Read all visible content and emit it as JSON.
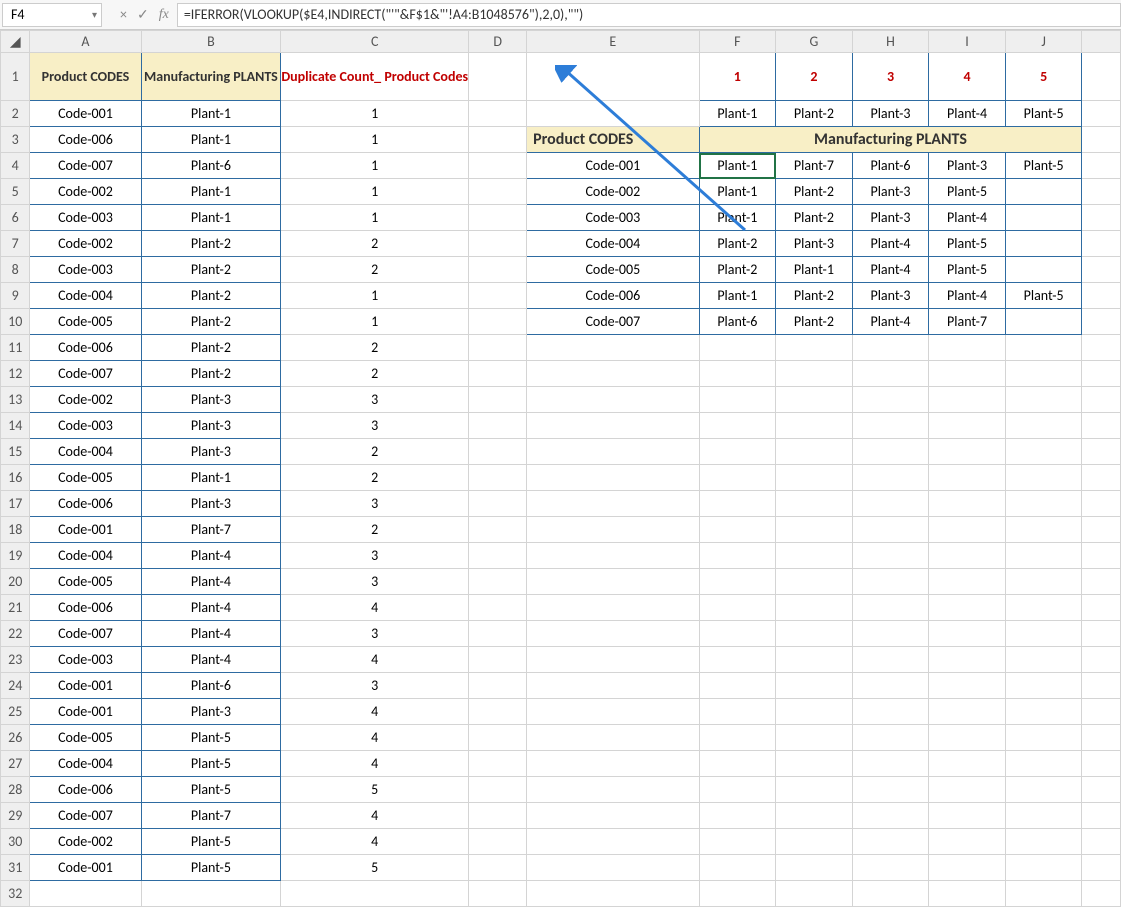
{
  "name_box": "F4",
  "formula_bar": "=IFERROR(VLOOKUP($E4,INDIRECT(\"'\"&F$1&\"'!A4:B1048576\"),2,0),\"\")",
  "icons": {
    "cancel": "×",
    "enter": "✓",
    "fx": "fx"
  },
  "col_headers": [
    "A",
    "B",
    "C",
    "D",
    "E",
    "F",
    "G",
    "H",
    "I",
    "J",
    ""
  ],
  "row_headers": [
    "1",
    "2",
    "3",
    "4",
    "5",
    "6",
    "7",
    "8",
    "9",
    "10",
    "11",
    "12",
    "13",
    "14",
    "15",
    "16",
    "17",
    "18",
    "19",
    "20",
    "21",
    "22",
    "23",
    "24",
    "25",
    "26",
    "27",
    "28",
    "29",
    "30",
    "31",
    "32"
  ],
  "row1": {
    "A": "Product CODES",
    "B": "Manufacturing PLANTS",
    "C": "Duplicate Count_ Product Codes",
    "F": "1",
    "G": "2",
    "H": "3",
    "I": "4",
    "J": "5"
  },
  "row2": {
    "F": "Plant-1",
    "G": "Plant-2",
    "H": "Plant-3",
    "I": "Plant-4",
    "J": "Plant-5"
  },
  "row3": {
    "E": "Product CODES",
    "FtoJ": "Manufacturing PLANTS"
  },
  "left_table": [
    {
      "A": "Code-001",
      "B": "Plant-1",
      "C": "1"
    },
    {
      "A": "Code-006",
      "B": "Plant-1",
      "C": "1"
    },
    {
      "A": "Code-007",
      "B": "Plant-6",
      "C": "1"
    },
    {
      "A": "Code-002",
      "B": "Plant-1",
      "C": "1"
    },
    {
      "A": "Code-003",
      "B": "Plant-1",
      "C": "1"
    },
    {
      "A": "Code-002",
      "B": "Plant-2",
      "C": "2"
    },
    {
      "A": "Code-003",
      "B": "Plant-2",
      "C": "2"
    },
    {
      "A": "Code-004",
      "B": "Plant-2",
      "C": "1"
    },
    {
      "A": "Code-005",
      "B": "Plant-2",
      "C": "1"
    },
    {
      "A": "Code-006",
      "B": "Plant-2",
      "C": "2"
    },
    {
      "A": "Code-007",
      "B": "Plant-2",
      "C": "2"
    },
    {
      "A": "Code-002",
      "B": "Plant-3",
      "C": "3"
    },
    {
      "A": "Code-003",
      "B": "Plant-3",
      "C": "3"
    },
    {
      "A": "Code-004",
      "B": "Plant-3",
      "C": "2"
    },
    {
      "A": "Code-005",
      "B": "Plant-1",
      "C": "2"
    },
    {
      "A": "Code-006",
      "B": "Plant-3",
      "C": "3"
    },
    {
      "A": "Code-001",
      "B": "Plant-7",
      "C": "2"
    },
    {
      "A": "Code-004",
      "B": "Plant-4",
      "C": "3"
    },
    {
      "A": "Code-005",
      "B": "Plant-4",
      "C": "3"
    },
    {
      "A": "Code-006",
      "B": "Plant-4",
      "C": "4"
    },
    {
      "A": "Code-007",
      "B": "Plant-4",
      "C": "3"
    },
    {
      "A": "Code-003",
      "B": "Plant-4",
      "C": "4"
    },
    {
      "A": "Code-001",
      "B": "Plant-6",
      "C": "3"
    },
    {
      "A": "Code-001",
      "B": "Plant-3",
      "C": "4"
    },
    {
      "A": "Code-005",
      "B": "Plant-5",
      "C": "4"
    },
    {
      "A": "Code-004",
      "B": "Plant-5",
      "C": "4"
    },
    {
      "A": "Code-006",
      "B": "Plant-5",
      "C": "5"
    },
    {
      "A": "Code-007",
      "B": "Plant-7",
      "C": "4"
    },
    {
      "A": "Code-002",
      "B": "Plant-5",
      "C": "4"
    },
    {
      "A": "Code-001",
      "B": "Plant-5",
      "C": "5"
    }
  ],
  "right_table": [
    {
      "E": "Code-001",
      "F": "Plant-1",
      "G": "Plant-7",
      "H": "Plant-6",
      "I": "Plant-3",
      "J": "Plant-5"
    },
    {
      "E": "Code-002",
      "F": "Plant-1",
      "G": "Plant-2",
      "H": "Plant-3",
      "I": "Plant-5",
      "J": ""
    },
    {
      "E": "Code-003",
      "F": "Plant-1",
      "G": "Plant-2",
      "H": "Plant-3",
      "I": "Plant-4",
      "J": ""
    },
    {
      "E": "Code-004",
      "F": "Plant-2",
      "G": "Plant-3",
      "H": "Plant-4",
      "I": "Plant-5",
      "J": ""
    },
    {
      "E": "Code-005",
      "F": "Plant-2",
      "G": "Plant-1",
      "H": "Plant-4",
      "I": "Plant-5",
      "J": ""
    },
    {
      "E": "Code-006",
      "F": "Plant-1",
      "G": "Plant-2",
      "H": "Plant-3",
      "I": "Plant-4",
      "J": "Plant-5"
    },
    {
      "E": "Code-007",
      "F": "Plant-6",
      "G": "Plant-2",
      "H": "Plant-4",
      "I": "Plant-7",
      "J": ""
    }
  ],
  "selected_cell": "F4"
}
